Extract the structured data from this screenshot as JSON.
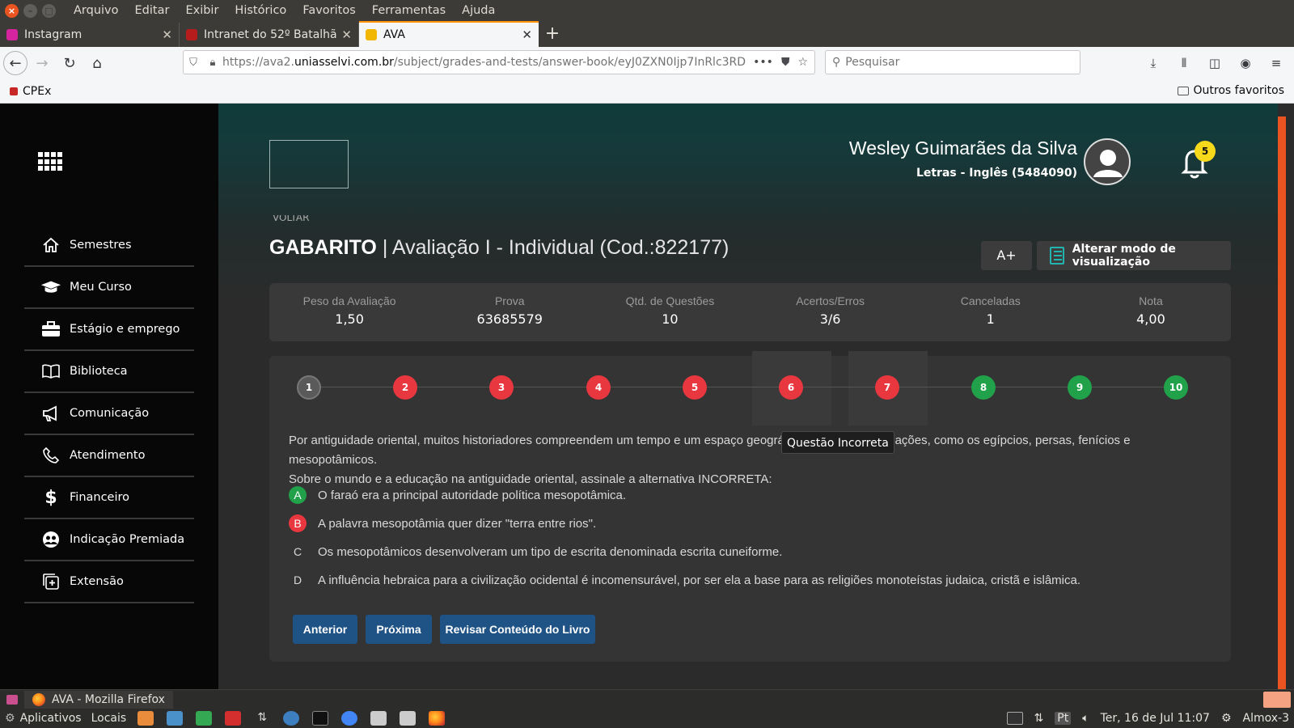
{
  "browser": {
    "menu": [
      "Arquivo",
      "Editar",
      "Exibir",
      "Histórico",
      "Favoritos",
      "Ferramentas",
      "Ajuda"
    ],
    "tabs": [
      {
        "label": "Instagram",
        "favicon_color": "#d6249f"
      },
      {
        "label": "Intranet do 52º Batalhão",
        "favicon_color": "#b71c1c"
      },
      {
        "label": "AVA",
        "favicon_color": "#f2b705"
      }
    ],
    "url_prefix": "https://ava2.",
    "url_domain": "uniasselvi.com.br",
    "url_path": "/subject/grades-and-tests/answer-book/eyJ0ZXN0Ijp7InRlc3RD",
    "search_placeholder": "Pesquisar",
    "bookmark": "CPEx",
    "other_bookmarks": "Outros favoritos"
  },
  "user": {
    "name": "Wesley Guimarães da Silva",
    "course": "Letras - Inglês (5484090)",
    "notifications": "5"
  },
  "sidebar": {
    "items": [
      {
        "label": "Semestres",
        "icon": "home-icon"
      },
      {
        "label": "Meu Curso",
        "icon": "graduation-cap-icon"
      },
      {
        "label": "Estágio e emprego",
        "icon": "briefcase-icon"
      },
      {
        "label": "Biblioteca",
        "icon": "book-icon"
      },
      {
        "label": "Comunicação",
        "icon": "megaphone-icon"
      },
      {
        "label": "Atendimento",
        "icon": "phone-icon"
      },
      {
        "label": "Financeiro",
        "icon": "dollar-icon"
      },
      {
        "label": "Indicação Premiada",
        "icon": "users-icon"
      },
      {
        "label": "Extensão",
        "icon": "plus-square-icon"
      }
    ]
  },
  "page": {
    "back_label": "VOLTAR",
    "title_bold": "GABARITO",
    "title_rest": " | Avaliação I - Individual (Cod.:822177)",
    "font_button": "A+",
    "view_mode_button": "Alterar modo de visualização"
  },
  "stats": [
    {
      "label": "Peso da Avaliação",
      "value": "1,50"
    },
    {
      "label": "Prova",
      "value": "63685579"
    },
    {
      "label": "Qtd. de Questões",
      "value": "10"
    },
    {
      "label": "Acertos/Erros",
      "value": "3/6"
    },
    {
      "label": "Canceladas",
      "value": "1"
    },
    {
      "label": "Nota",
      "value": "4,00"
    }
  ],
  "questions": [
    {
      "n": "1",
      "status": "gray"
    },
    {
      "n": "2",
      "status": "red"
    },
    {
      "n": "3",
      "status": "red"
    },
    {
      "n": "4",
      "status": "red"
    },
    {
      "n": "5",
      "status": "red"
    },
    {
      "n": "6",
      "status": "red"
    },
    {
      "n": "7",
      "status": "red"
    },
    {
      "n": "8",
      "status": "green"
    },
    {
      "n": "9",
      "status": "green"
    },
    {
      "n": "10",
      "status": "green"
    }
  ],
  "tooltip": "Questão Incorreta",
  "question": {
    "line1": "Por antiguidade oriental, muitos historiadores compreendem um tempo e um espaço geográfico de antigas civilizações, como os egípcios, persas, fenícios e mesopotâmicos.",
    "line2": "Sobre o mundo e a educação na antiguidade oriental, assinale a alternativa INCORRETA:",
    "options": [
      {
        "letter": "A",
        "text": "O faraó era a principal autoridade política mesopotâmica.",
        "mark": "green"
      },
      {
        "letter": "B",
        "text": "A palavra mesopotâmia quer dizer \"terra entre rios\".",
        "mark": "red"
      },
      {
        "letter": "C",
        "text": "Os mesopotâmicos desenvolveram um tipo de escrita denominada escrita cuneiforme.",
        "mark": "plain"
      },
      {
        "letter": "D",
        "text": "A influência hebraica para a civilização ocidental é incomensurável, por ser ela a base para as religiões monoteístas judaica, cristã e islâmica.",
        "mark": "plain"
      }
    ]
  },
  "buttons": {
    "previous": "Anterior",
    "next": "Próxima",
    "review": "Revisar Conteúdo do Livro"
  },
  "taskbar": {
    "window": "AVA - Mozilla Firefox",
    "apps": "Aplicativos",
    "places": "Locais",
    "lang": "Pt",
    "clock": "Ter, 16 de Jul 11:07",
    "host": "Almox-3"
  }
}
